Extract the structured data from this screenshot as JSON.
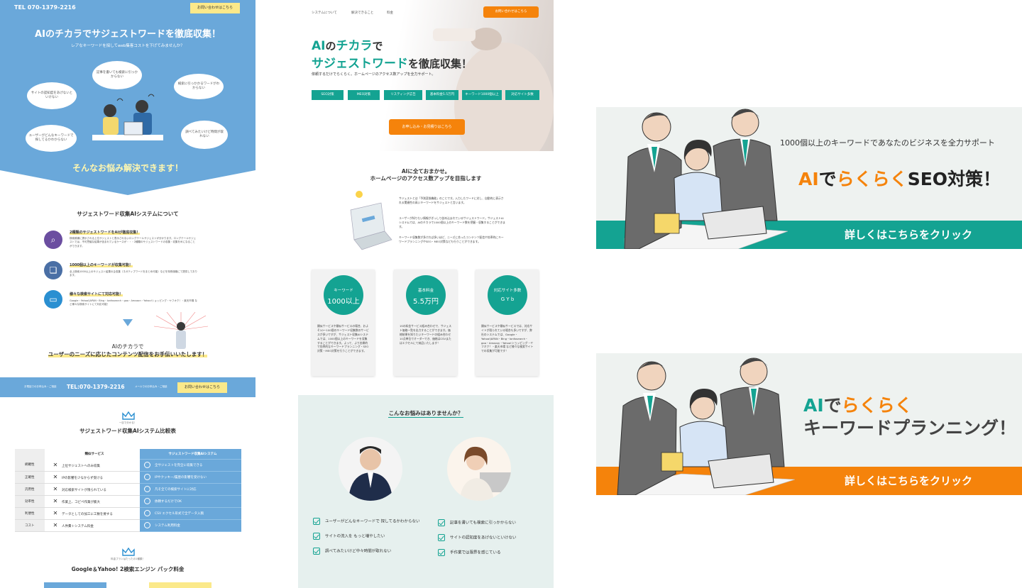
{
  "left": {
    "tel": "TEL 070-1379-2216",
    "contact_btn": "お問い合わせはこちら",
    "hero_title": "AIのチカラでサジェストワードを徹底収集！",
    "hero_sub": "レアなキーワードを探してweb集客コストを下げてみませんか？",
    "bubbles": [
      "記事を書いても検索に引っかからない",
      "サイトの認知度をあげないといけない",
      "検索に引っかかるワードがわからない",
      "ユーザーがどんなキーワードで探してるかわからない",
      "調べてみたいけど時間が取れない"
    ],
    "solve": "そんなお悩み解決できます！",
    "system_title": "サジェストワード収集AIシステムについて",
    "features": [
      {
        "title": "2種類のサジェストワードをAIが徹底収集！",
        "desc": "検索候補に提示される上位サジェストと表示されないロングテールサジェストが分かります。ロングテールサジェストでは、不可思議な結果が含まれているケースが・・・2種類のサジェストワードの収集・収集をめになることができます。"
      },
      {
        "title": "1000個以上のキーワードが収集可能！",
        "desc": "全上検索1000以上のサジェスト結果の企収集（ネガティブワードをまとめ可能）などを特別価格にて提供しております。"
      },
      {
        "title": "様々な検索サイトにて対応可能！",
        "desc": "Google・Yahoo!JAPAN・Bing・Ionfosearch・goo・Amazon・Yahoo!ショッピング・ヤフオク！・楽天市場 など様々な検索サイトにて対応可能！"
      }
    ],
    "ai_line1": "AIのチカラで",
    "ai_line2": "ユーザーのニーズに応じたコンテンツ配信をお手伝いいたします！",
    "bar": {
      "s1": "お電話でのお申込み・ご相談",
      "tel": "TEL:070-1379-2216",
      "s2": "メールでのお申込み・ご相談",
      "btn": "お問い合わせはこちら"
    },
    "compare_small": "一目で分かる！",
    "compare_title": "サジェストワード収集AIシステム比較表",
    "compare_headers": [
      "",
      "類似サービス",
      "サジェストワード収集AIシステム"
    ],
    "compare_rows": [
      {
        "label": "網羅性",
        "bad": "上位サジェストへのみ収集",
        "good": "全サジェストを完全に収集できる"
      },
      {
        "label": "正確性",
        "bad": "IPの影響を少なからず受ける",
        "good": "IPやクッキー/履歴の影響を受けない"
      },
      {
        "label": "汎用性",
        "bad": "対応検索サイトが限られている",
        "good": "凡そ全ての検索サイトに対応"
      },
      {
        "label": "効率性",
        "bad": "作業上、コピペ作業が膨大",
        "good": "依頼するだけでOK"
      },
      {
        "label": "利便性",
        "bad": "データとしての加工に工数を要する",
        "good": "CSV エクセル形式で全データ入稿"
      },
      {
        "label": "コスト",
        "bad": "人件費＋システム料金",
        "good": "システム利用料金"
      }
    ],
    "pack_small": "料金プランはたったの1種類！",
    "pack_title": "Google＆Yahoo! 2検索エンジン パック料金"
  },
  "middle": {
    "nav": [
      "システムについて",
      "解決できること",
      "料金"
    ],
    "contact_btn": "お問い合わせはこちら",
    "hero_ai": "AI",
    "hero_no": "の",
    "hero_chikara": "チカラ",
    "hero_de": "で",
    "hero_suggest": "サジェストワード",
    "hero_tail": "を徹底収集！",
    "lead": "依頼するだけでらくらく。ホームページのアクセス数アップを全力サポート。",
    "tags": [
      "SEO対策",
      "MEO対策",
      "リスティング広告",
      "基本料金5.5万円",
      "キーワード1000個以上",
      "対応サイト多数"
    ],
    "cta": "お申し込み・お見積りはこちら",
    "sec_title1": "AIに全ておまかせ。",
    "sec_title2": "ホームページのアクセス数アップを目指します",
    "body": [
      "サジェストとは「予測変換機能」のことです。入力したワードに対し、自動的に表示される関連性の高いキーワードをサジェストと言います。",
      "ユーザーが知りたい情報がぎっしり詰め込まれているサジェストワード。サジェストAIシステムでは、AIのチカラで1000個以上のキーワード数を把握・収集することができます。",
      "キーワード収集数が多ければ多いほど、ニーズに合ったコンテンツ配信や効率的にキーワードプランニングやSEO・MEO対策なども行うことができます。"
    ],
    "cards": [
      {
        "a": "キーワード",
        "b": "1000以上",
        "desc": "類似サービスや類似サービスの場合、およそ10〜100個のキーワード収集数のサービスが多いですが、サジェスト収集AIシステムでは、1000個以上のキーワードを収集することができます。よって、より効果的で効率的なキーワードプランニング・SEO対策・MEO対策を行うことができます。"
      },
      {
        "a": "基本料金",
        "b": "5.5万円",
        "desc": "1Sの料金サービス組み合わせで、サジェスト価格一覧を出力することができます。価格結果を知りたいキーワードの組み合わせ10点単位でオーダーでき、価格はCSVまたはエクセルにて納品いたします！"
      },
      {
        "a": "対応サイト多数",
        "b": "G Y b",
        "desc": "類似サービスや類似サービスでは、対応サイトが限られている場合も多いですが、弊社のシステムでは、Google・Yahoo!JAPAN・Bing・Ionfosearch・goo・Amazon・Yahoo!ショッピング・ヤフオク！・楽天市場 など様々な検索サイトでの収集が可能です！"
      }
    ],
    "worry_title": "こんなお悩みはありませんか？",
    "checks_left": [
      "ユーザーがどんなキーワードで 探してるかわからない",
      "サイトの流入を もっと増やしたい",
      "調べてみたいけど中々時間が取れない"
    ],
    "checks_right": [
      "記事を書いても検索に引っかからない",
      "サイトの認知度をあげないといけない",
      "手作業では限界を感じている"
    ]
  },
  "banner1": {
    "sub": "1000個以上のキーワードであなたのビジネスを全力サポート",
    "ai": "AI",
    "de": "で",
    "rakuraku": "らくらく",
    "seo": "SEO対策！",
    "cta": "詳しくはこちらをクリック"
  },
  "banner2": {
    "ai": "AI",
    "de": "で",
    "rakuraku": "らくらく",
    "line2": "キーワードプランニング！",
    "cta": "詳しくはこちらをクリック"
  },
  "colors": {
    "blue": "#6aa8da",
    "teal": "#14a392",
    "orange": "#f5830b",
    "yellow": "#fbe98a"
  }
}
